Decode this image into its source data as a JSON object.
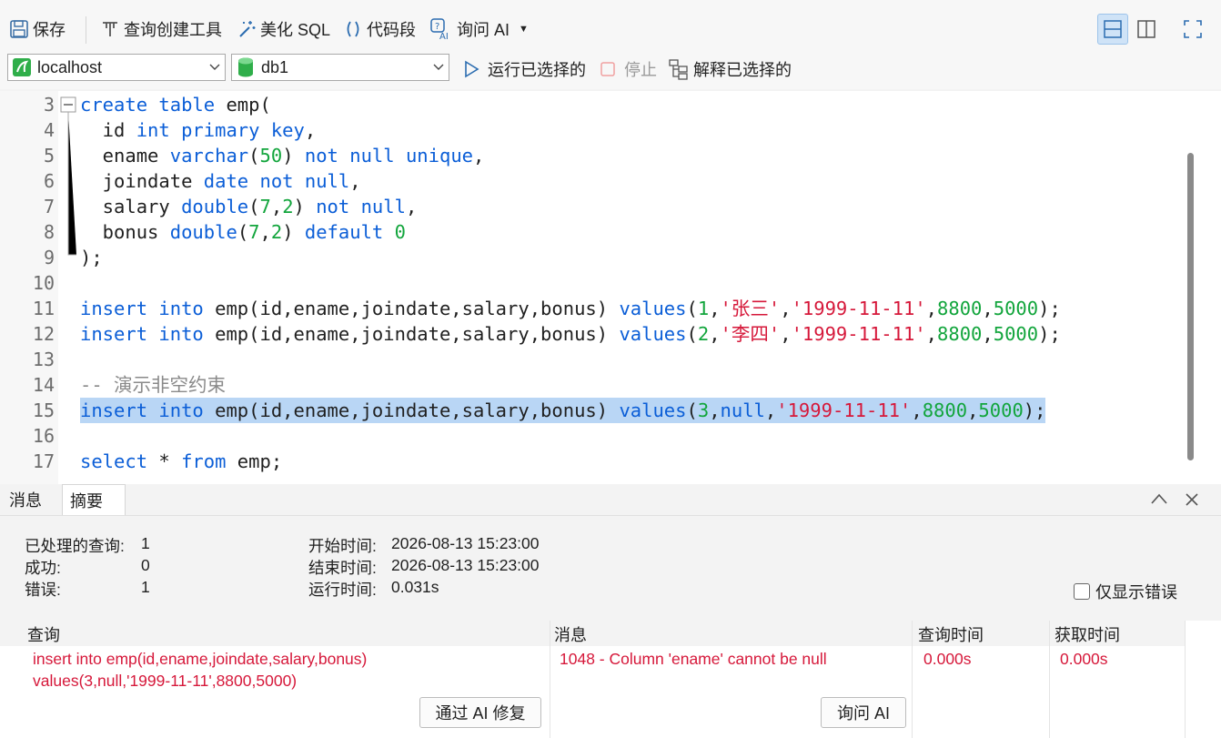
{
  "toolbar": {
    "save": "保存",
    "query_builder": "查询创建工具",
    "beautify": "美化 SQL",
    "snippet": "代码段",
    "ask_ai": "询问 AI"
  },
  "connection": {
    "server": "localhost",
    "database": "db1",
    "run_selected": "运行已选择的",
    "stop": "停止",
    "explain_selected": "解释已选择的"
  },
  "editor": {
    "lines": [
      {
        "n": "3",
        "tokens": [
          [
            "kw",
            "create"
          ],
          [
            "t",
            " "
          ],
          [
            "kw",
            "table"
          ],
          [
            "t",
            " emp("
          ]
        ]
      },
      {
        "n": "4",
        "tokens": [
          [
            "t",
            "  id "
          ],
          [
            "kw",
            "int"
          ],
          [
            "t",
            " "
          ],
          [
            "kw",
            "primary"
          ],
          [
            "t",
            " "
          ],
          [
            "kw",
            "key"
          ],
          [
            "t",
            ","
          ]
        ]
      },
      {
        "n": "5",
        "tokens": [
          [
            "t",
            "  ename "
          ],
          [
            "kw",
            "varchar"
          ],
          [
            "t",
            "("
          ],
          [
            "num",
            "50"
          ],
          [
            "t",
            ") "
          ],
          [
            "kw",
            "not"
          ],
          [
            "t",
            " "
          ],
          [
            "kw",
            "null"
          ],
          [
            "t",
            " "
          ],
          [
            "kw",
            "unique"
          ],
          [
            "t",
            ","
          ]
        ]
      },
      {
        "n": "6",
        "tokens": [
          [
            "t",
            "  joindate "
          ],
          [
            "kw",
            "date"
          ],
          [
            "t",
            " "
          ],
          [
            "kw",
            "not"
          ],
          [
            "t",
            " "
          ],
          [
            "kw",
            "null"
          ],
          [
            "t",
            ","
          ]
        ]
      },
      {
        "n": "7",
        "tokens": [
          [
            "t",
            "  salary "
          ],
          [
            "kw",
            "double"
          ],
          [
            "t",
            "("
          ],
          [
            "num",
            "7"
          ],
          [
            "t",
            ","
          ],
          [
            "num",
            "2"
          ],
          [
            "t",
            ") "
          ],
          [
            "kw",
            "not"
          ],
          [
            "t",
            " "
          ],
          [
            "kw",
            "null"
          ],
          [
            "t",
            ","
          ]
        ]
      },
      {
        "n": "8",
        "tokens": [
          [
            "t",
            "  bonus "
          ],
          [
            "kw",
            "double"
          ],
          [
            "t",
            "("
          ],
          [
            "num",
            "7"
          ],
          [
            "t",
            ","
          ],
          [
            "num",
            "2"
          ],
          [
            "t",
            ") "
          ],
          [
            "kw",
            "default"
          ],
          [
            "t",
            " "
          ],
          [
            "num",
            "0"
          ]
        ]
      },
      {
        "n": "9",
        "tokens": [
          [
            "t",
            ");"
          ]
        ]
      },
      {
        "n": "10",
        "tokens": []
      },
      {
        "n": "11",
        "tokens": [
          [
            "kw",
            "insert"
          ],
          [
            "t",
            " "
          ],
          [
            "kw",
            "into"
          ],
          [
            "t",
            " emp(id,ename,joindate,salary,bonus) "
          ],
          [
            "kw",
            "values"
          ],
          [
            "t",
            "("
          ],
          [
            "num",
            "1"
          ],
          [
            "t",
            ","
          ],
          [
            "str",
            "'张三'"
          ],
          [
            "t",
            ","
          ],
          [
            "str",
            "'1999-11-11'"
          ],
          [
            "t",
            ","
          ],
          [
            "num",
            "8800"
          ],
          [
            "t",
            ","
          ],
          [
            "num",
            "5000"
          ],
          [
            "t",
            ");"
          ]
        ]
      },
      {
        "n": "12",
        "tokens": [
          [
            "kw",
            "insert"
          ],
          [
            "t",
            " "
          ],
          [
            "kw",
            "into"
          ],
          [
            "t",
            " emp(id,ename,joindate,salary,bonus) "
          ],
          [
            "kw",
            "values"
          ],
          [
            "t",
            "("
          ],
          [
            "num",
            "2"
          ],
          [
            "t",
            ","
          ],
          [
            "str",
            "'李四'"
          ],
          [
            "t",
            ","
          ],
          [
            "str",
            "'1999-11-11'"
          ],
          [
            "t",
            ","
          ],
          [
            "num",
            "8800"
          ],
          [
            "t",
            ","
          ],
          [
            "num",
            "5000"
          ],
          [
            "t",
            ");"
          ]
        ]
      },
      {
        "n": "13",
        "tokens": []
      },
      {
        "n": "14",
        "tokens": [
          [
            "cm",
            "-- 演示非空约束"
          ]
        ]
      },
      {
        "n": "15",
        "highlight": true,
        "tokens": [
          [
            "kw",
            "insert"
          ],
          [
            "t",
            " "
          ],
          [
            "kw",
            "into"
          ],
          [
            "t",
            " emp(id,ename,joindate,salary,bonus) "
          ],
          [
            "kw",
            "values"
          ],
          [
            "t",
            "("
          ],
          [
            "num",
            "3"
          ],
          [
            "t",
            ","
          ],
          [
            "kw",
            "null"
          ],
          [
            "t",
            ","
          ],
          [
            "str",
            "'1999-11-11'"
          ],
          [
            "t",
            ","
          ],
          [
            "num",
            "8800"
          ],
          [
            "t",
            ","
          ],
          [
            "num",
            "5000"
          ],
          [
            "t",
            ");"
          ]
        ]
      },
      {
        "n": "16",
        "tokens": []
      },
      {
        "n": "17",
        "tokens": [
          [
            "kw",
            "select"
          ],
          [
            "t",
            " * "
          ],
          [
            "kw",
            "from"
          ],
          [
            "t",
            " emp;"
          ]
        ]
      }
    ]
  },
  "panel": {
    "tabs": [
      "消息",
      "摘要"
    ],
    "summary": {
      "processed_label": "已处理的查询:",
      "processed_value": "1",
      "success_label": "成功:",
      "success_value": "0",
      "error_label": "错误:",
      "error_value": "1",
      "start_label": "开始时间:",
      "start_value": "2026-08-13 15:23:00",
      "end_label": "结束时间:",
      "end_value": "2026-08-13 15:23:00",
      "run_label": "运行时间:",
      "run_value": "0.031s"
    },
    "only_errors": "仅显示错误",
    "columns": [
      "查询",
      "消息",
      "查询时间",
      "获取时间"
    ],
    "row": {
      "query_line1": "insert into emp(id,ename,joindate,salary,bonus)",
      "query_line2": "values(3,null,'1999-11-11',8800,5000)",
      "message": "1048 - Column 'ename' cannot be null",
      "query_time": "0.000s",
      "fetch_time": "0.000s"
    },
    "fix_with_ai": "通过 AI 修复",
    "ask_ai": "询问 AI"
  }
}
